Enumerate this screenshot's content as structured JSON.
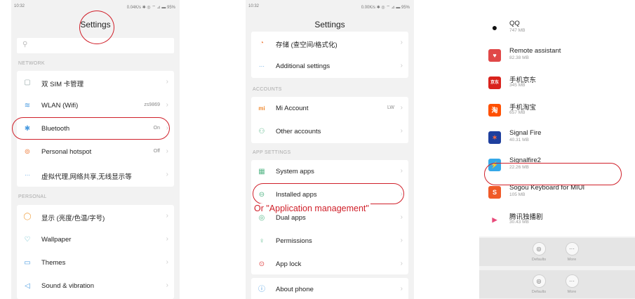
{
  "screen1": {
    "status_time": "10:32",
    "status_right": "0.04K/s ✱ ◎ ⌔ ⊿ ▬ 95%",
    "title": "Settings",
    "search_icon": "search-icon",
    "network": {
      "header": "NETWORK",
      "rows": [
        {
          "icon": "▢",
          "label": "双 SIM 卡管理",
          "value": ""
        },
        {
          "icon": "≋",
          "label": "WLAN (Wifi)",
          "value": "zs9869"
        },
        {
          "icon": "✱",
          "label": "Bluetooth",
          "value": "On"
        },
        {
          "icon": "⊚",
          "label": "Personal hotspot",
          "value": "Off"
        },
        {
          "icon": "···",
          "label": "虚拟代理,网络共享,无线显示等",
          "value": ""
        }
      ]
    },
    "personal": {
      "header": "PERSONAL",
      "rows": [
        {
          "icon": "◯",
          "label": "显示 (亮度/色温/字号)",
          "value": ""
        },
        {
          "icon": "♡",
          "label": "Wallpaper",
          "value": ""
        },
        {
          "icon": "▭",
          "label": "Themes",
          "value": ""
        },
        {
          "icon": "◁",
          "label": "Sound & vibration",
          "value": ""
        }
      ]
    }
  },
  "screen2": {
    "status_time": "10:32",
    "status_right": "0.00K/s ✱ ◎ ⌔ ⊿ ▬ 95%",
    "title": "Settings",
    "top_rows": [
      {
        "icon": "◔",
        "label": "存储 (查空间/格式化)",
        "value": ""
      },
      {
        "icon": "···",
        "label": "Additional settings",
        "value": ""
      }
    ],
    "accounts": {
      "header": "ACCOUNTS",
      "rows": [
        {
          "icon": "mi",
          "label": "Mi Account",
          "value": "LW"
        },
        {
          "icon": "⚇",
          "label": "Other accounts",
          "value": ""
        }
      ]
    },
    "app_settings": {
      "header": "APP SETTINGS",
      "rows": [
        {
          "icon": "▦",
          "label": "System apps",
          "value": ""
        },
        {
          "icon": "⊖",
          "label": "Installed apps",
          "value": ""
        },
        {
          "icon": "◎",
          "label": "Dual apps",
          "value": ""
        },
        {
          "icon": "♀",
          "label": "Permissions",
          "value": ""
        },
        {
          "icon": "⊙",
          "label": "App lock",
          "value": ""
        }
      ]
    },
    "about": {
      "icon": "ⓘ",
      "label": "About phone"
    },
    "annotation": "Or \"Application management\""
  },
  "screen3": {
    "apps": [
      {
        "icon_name": "qq-icon",
        "glyph": "●",
        "color": "#ffffff",
        "name": "QQ",
        "size": "747 MB"
      },
      {
        "icon_name": "remote-assistant-icon",
        "glyph": "♥",
        "color": "#e04848",
        "name": "Remote assistant",
        "size": "82.38 MB"
      },
      {
        "icon_name": "jd-icon",
        "glyph": "京东",
        "color": "#d9231d",
        "name": "手机京东",
        "size": "345 MB"
      },
      {
        "icon_name": "taobao-icon",
        "glyph": "淘",
        "color": "#ff5000",
        "name": "手机淘宝",
        "size": "657 MB"
      },
      {
        "icon_name": "signal-fire-icon",
        "glyph": "✶",
        "color": "#1e3f9e",
        "name": "Signal Fire",
        "size": "40.31 MB"
      },
      {
        "icon_name": "signalfire2-icon",
        "glyph": "⚡",
        "color": "#35a8e8",
        "name": "Signalfire2",
        "size": "22.26 MB"
      },
      {
        "icon_name": "sogou-keyboard-icon",
        "glyph": "S",
        "color": "#f05a28",
        "name": "Sogou Keyboard for MIUI",
        "size": "105 MB"
      },
      {
        "icon_name": "tencent-video-icon",
        "glyph": "▶",
        "color": "#ffffff",
        "name": "腾讯独播剧",
        "size": "30.43 MB"
      }
    ],
    "bar": {
      "defaults": "Defaults",
      "more": "More",
      "defaults_glyph": "◎",
      "more_glyph": "···"
    }
  },
  "colors": {
    "annotation": "#d0202a",
    "background": "#f2f2f2",
    "card": "#ffffff"
  }
}
